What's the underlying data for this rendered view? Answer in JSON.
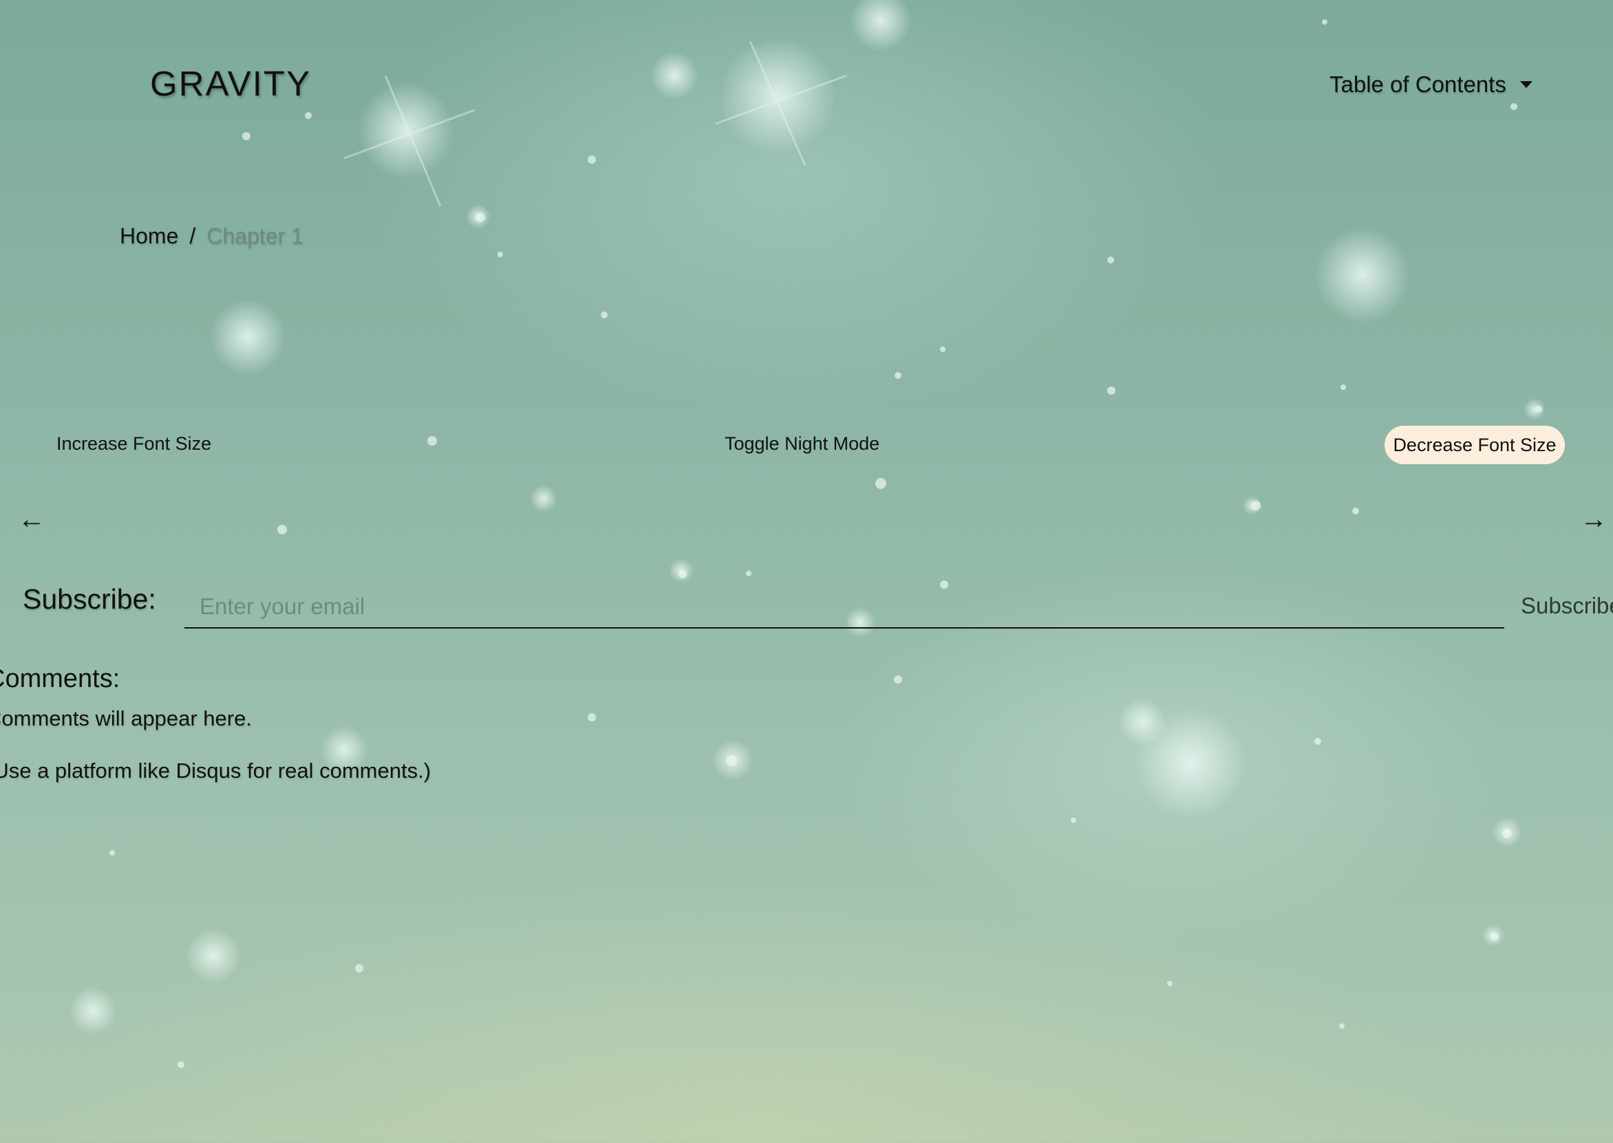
{
  "header": {
    "brand": "GRAVITY",
    "toc_label": "Table of Contents",
    "toc_icon": "caret-down-icon"
  },
  "breadcrumb": {
    "home": "Home",
    "separator": "/",
    "current": "Chapter 1"
  },
  "controls": {
    "increase_font": "Increase Font Size",
    "toggle_night": "Toggle Night Mode",
    "decrease_font": "Decrease Font Size"
  },
  "navigation": {
    "prev_arrow": "←",
    "next_arrow": "→"
  },
  "subscribe": {
    "label": "Subscribe:",
    "placeholder": "Enter your email",
    "value": "",
    "button": "Subscribe"
  },
  "comments": {
    "heading": "Comments:",
    "line1": "Comments will appear here.",
    "line2": "(Use a platform like Disqus for real comments.)"
  },
  "colors": {
    "background_teal": "#8db5a5",
    "button_cream": "#fbeedd",
    "muted_text": "#6d8a82"
  }
}
